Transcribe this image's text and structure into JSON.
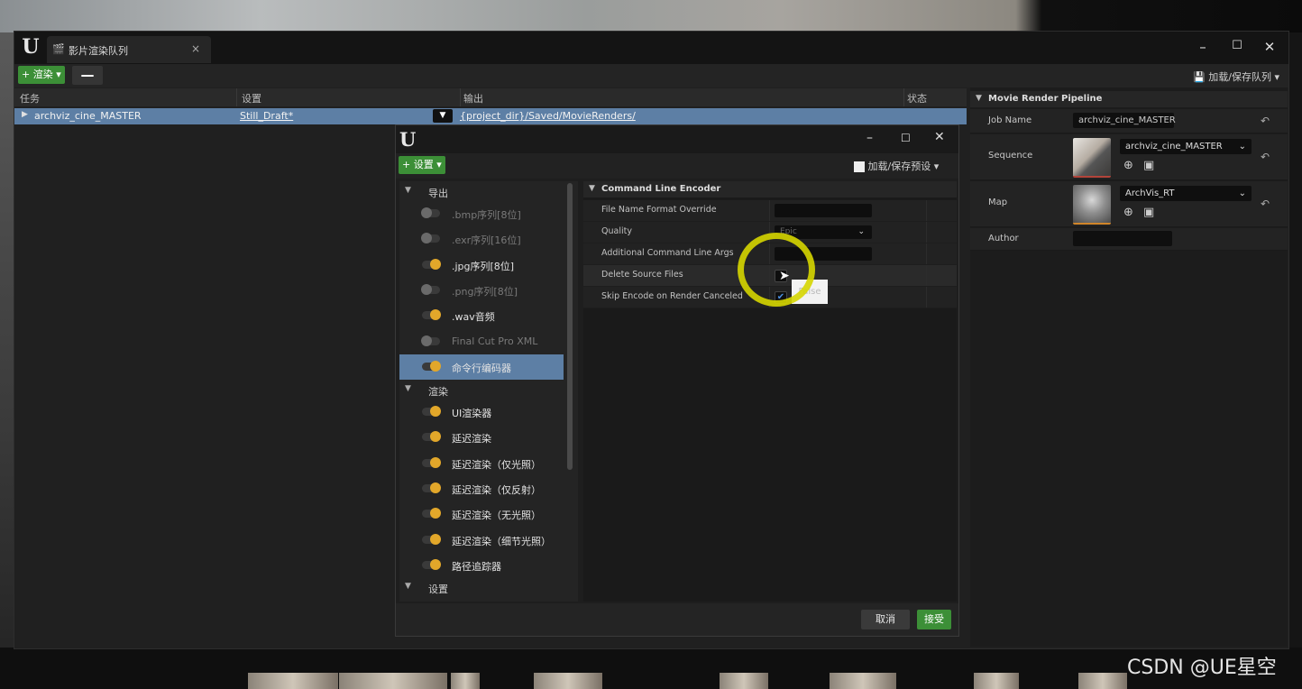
{
  "app": {
    "window_tab_title": "影片渲染队列",
    "toolbar": {
      "render_label": "渲染",
      "remove_label": "—",
      "load_save_queue_label": "加载/保存队列"
    }
  },
  "queue_table": {
    "headers": [
      "任务",
      "设置",
      "输出",
      "状态"
    ],
    "rows": [
      {
        "job": "archviz_cine_MASTER",
        "settings": "Still_Draft*",
        "output": "{project_dir}/Saved/MovieRenders/",
        "status": ""
      }
    ]
  },
  "details_panel": {
    "section_title": "Movie Render Pipeline",
    "job_name_label": "Job Name",
    "job_name_value": "archviz_cine_MASTER",
    "sequence_label": "Sequence",
    "sequence_value": "archviz_cine_MASTER",
    "map_label": "Map",
    "map_value": "ArchVis_RT",
    "author_label": "Author",
    "author_value": ""
  },
  "settings_dialog": {
    "add_settings_label": "设置",
    "load_save_preset_label": "加载/保存预设",
    "categories": [
      {
        "name": "导出",
        "items": [
          {
            "label": ".bmp序列[8位]",
            "enabled": false
          },
          {
            "label": ".exr序列[16位]",
            "enabled": false
          },
          {
            "label": ".jpg序列[8位]",
            "enabled": true
          },
          {
            "label": ".png序列[8位]",
            "enabled": false
          },
          {
            "label": ".wav音频",
            "enabled": true
          },
          {
            "label": "Final Cut Pro XML",
            "enabled": false
          },
          {
            "label": "命令行编码器",
            "enabled": true,
            "selected": true
          }
        ]
      },
      {
        "name": "渲染",
        "items": [
          {
            "label": "UI渲染器",
            "enabled": true
          },
          {
            "label": "延迟渲染",
            "enabled": true
          },
          {
            "label": "延迟渲染（仅光照）",
            "enabled": true
          },
          {
            "label": "延迟渲染（仅反射）",
            "enabled": true
          },
          {
            "label": "延迟渲染（无光照）",
            "enabled": true
          },
          {
            "label": "延迟渲染（细节光照）",
            "enabled": true
          },
          {
            "label": "路径追踪器",
            "enabled": true
          }
        ]
      },
      {
        "name": "设置",
        "items": []
      }
    ],
    "detail": {
      "section_title": "Command Line Encoder",
      "properties": [
        {
          "label": "File Name Format Override",
          "value": ""
        },
        {
          "label": "Quality",
          "value": "Epic"
        },
        {
          "label": "Additional Command Line Args",
          "value": ""
        },
        {
          "label": "Delete Source Files",
          "value": false
        },
        {
          "label": "Skip Encode on Render Canceled",
          "value": true
        }
      ],
      "tooltip": "False"
    },
    "cancel_label": "取消",
    "accept_label": "接受"
  },
  "watermark": "CSDN @UE星空",
  "colors": {
    "accent_green": "#3c8f37",
    "selection_blue": "#5d7fa5",
    "toggle_on": "#e2a72a",
    "highlight_ring": "#d6d600"
  }
}
